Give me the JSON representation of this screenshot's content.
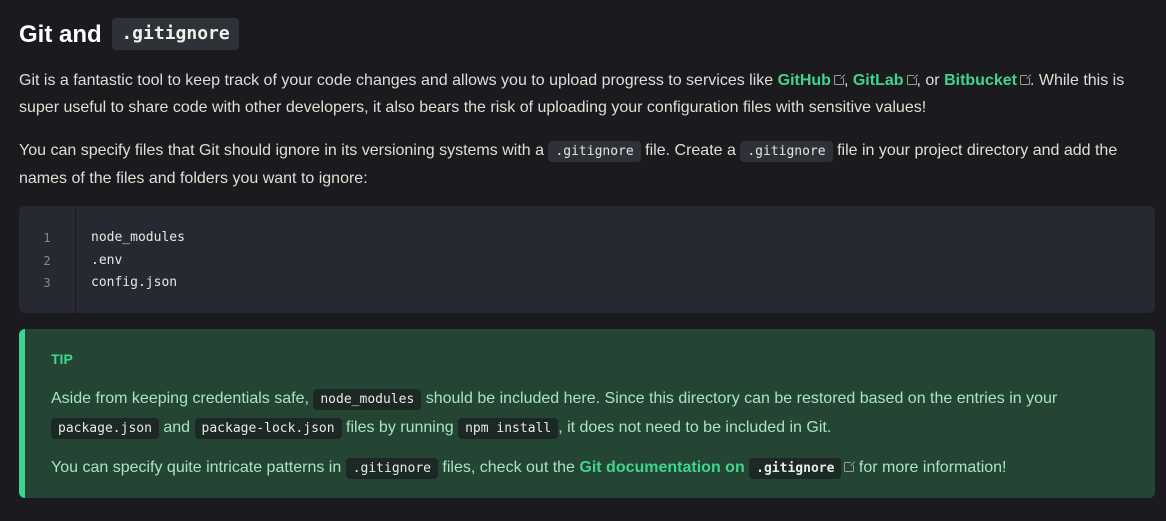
{
  "heading": {
    "text": "Git and",
    "code": ".gitignore"
  },
  "intro": {
    "p1_a": "Git is a fantastic tool to keep track of your code changes and allows you to upload progress to services like ",
    "link_github": "GitHub",
    "sep1": ", ",
    "link_gitlab": "GitLab",
    "sep2": ", or ",
    "link_bitbucket": "Bitbucket",
    "p1_b": ". While this is super useful to share code with other developers, it also bears the risk of uploading your configuration files with sensitive values!",
    "p2_a": "You can specify files that Git should ignore in its versioning systems with a ",
    "p2_code1": ".gitignore",
    "p2_b": " file. Create a ",
    "p2_code2": ".gitignore",
    "p2_c": " file in your project directory and add the names of the files and folders you want to ignore:"
  },
  "code_block": {
    "lines": [
      {
        "num": "1",
        "text": "node_modules"
      },
      {
        "num": "2",
        "text": ".env"
      },
      {
        "num": "3",
        "text": "config.json"
      }
    ]
  },
  "tip": {
    "title": "TIP",
    "p1_a": "Aside from keeping credentials safe, ",
    "p1_code1": "node_modules",
    "p1_b": " should be included here. Since this directory can be restored based on the entries in your ",
    "p1_code2": "package.json",
    "p1_c": " and ",
    "p1_code3": "package-lock.json",
    "p1_d": " files by running ",
    "p1_code4": "npm install",
    "p1_e": ", it does not need to be included in Git.",
    "p2_a": "You can specify quite intricate patterns in ",
    "p2_code1": ".gitignore",
    "p2_b": " files, check out the ",
    "p2_link": "Git documentation on ",
    "p2_link_code": ".gitignore",
    "p2_c": " for more information!"
  },
  "colors": {
    "background": "#1b1b1f",
    "accent": "#3dd68c",
    "tip_background": "#244534",
    "code_background": "#262931"
  }
}
